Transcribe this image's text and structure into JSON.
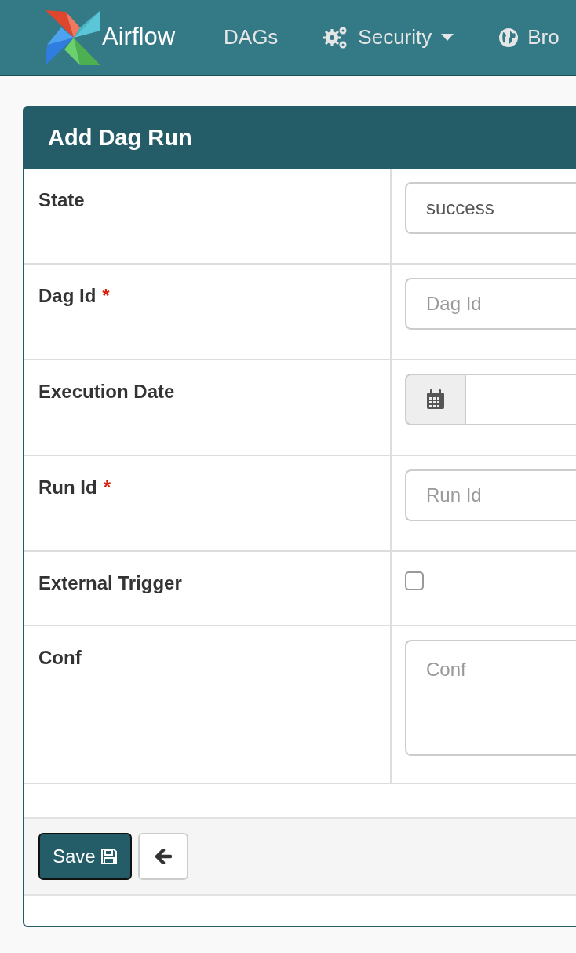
{
  "navbar": {
    "brand": "Airflow",
    "items": [
      {
        "label": "DAGs",
        "kind": "plain"
      },
      {
        "label": "Security",
        "kind": "menu"
      },
      {
        "label": "Bro",
        "kind": "link"
      }
    ]
  },
  "form": {
    "title": "Add Dag Run",
    "fields": [
      {
        "label": "State",
        "kind": "select",
        "value": "success"
      },
      {
        "label": "Dag Id",
        "mark": "*",
        "kind": "text",
        "placeholder": "Dag Id"
      },
      {
        "label": "Execution Date",
        "kind": "date"
      },
      {
        "label": "Run Id",
        "mark": "*",
        "kind": "text",
        "placeholder": "Run Id"
      },
      {
        "label": "External Trigger",
        "kind": "checkbox",
        "checked": false
      },
      {
        "label": "Conf",
        "kind": "textarea",
        "placeholder": "Conf"
      }
    ],
    "buttons": [
      {
        "label": "Save",
        "kind": "save"
      },
      {
        "kind": "back"
      }
    ]
  }
}
